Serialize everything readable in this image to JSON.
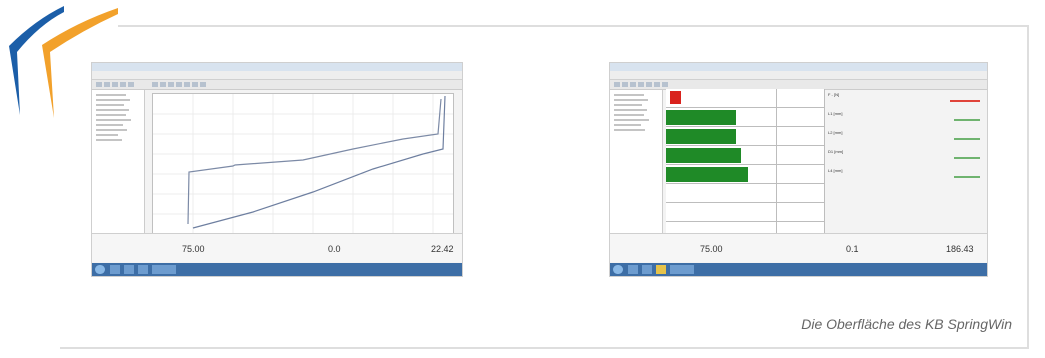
{
  "colors": {
    "logo_blue": "#1b5ea8",
    "logo_orange": "#f2a12b",
    "frame": "#dedede",
    "bar_green": "#1f8a27",
    "alert_red": "#d9221d",
    "caption": "#666666"
  },
  "left_screenshot": {
    "status_values": [
      "75.00",
      "0.0",
      "22.42"
    ]
  },
  "right_screenshot": {
    "param_labels": [
      "F - [N]",
      "L1 [mm]",
      "L2 [mm]",
      "D1 [mm]",
      "L4 [mm]"
    ],
    "status_values": [
      "75.00",
      "0.1",
      "186.43"
    ]
  },
  "caption": "Die Oberfläche des KB SpringWin"
}
